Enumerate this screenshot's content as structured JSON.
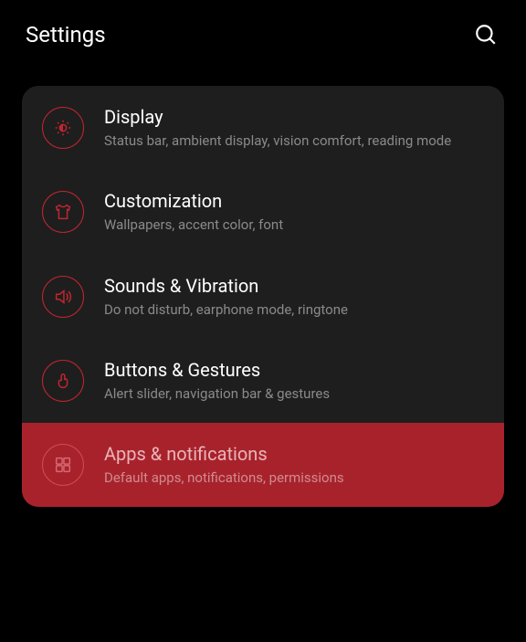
{
  "header": {
    "title": "Settings"
  },
  "items": [
    {
      "title": "Display",
      "subtitle": "Status bar, ambient display, vision comfort, reading mode"
    },
    {
      "title": "Customization",
      "subtitle": "Wallpapers, accent color, font"
    },
    {
      "title": "Sounds & Vibration",
      "subtitle": "Do not disturb, earphone mode, ringtone"
    },
    {
      "title": "Buttons & Gestures",
      "subtitle": "Alert slider, navigation bar & gestures"
    },
    {
      "title": "Apps & notifications",
      "subtitle": "Default apps, notifications, permissions"
    }
  ]
}
